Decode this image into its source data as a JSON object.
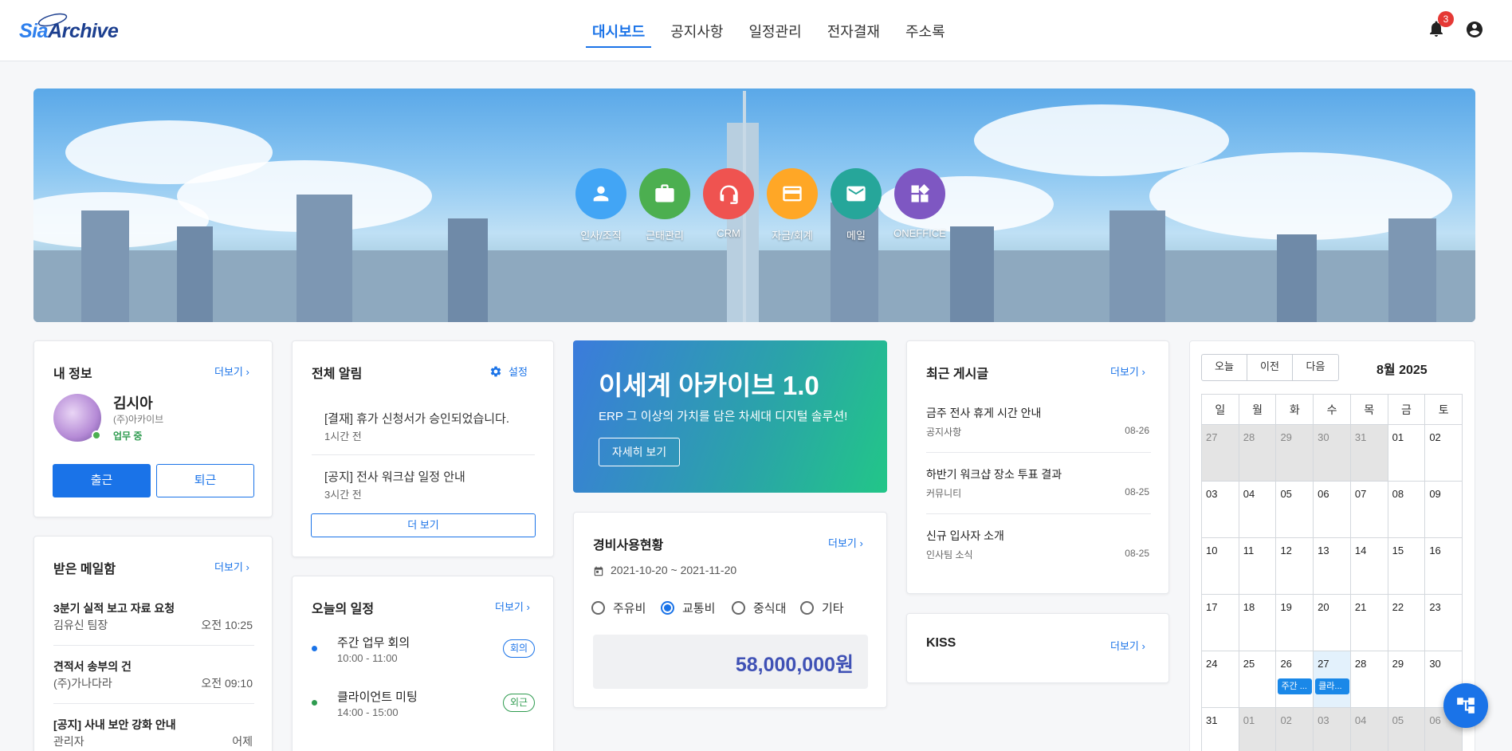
{
  "brand": {
    "logo_text_a": "Sia",
    "logo_text_b": "Archive"
  },
  "nav": [
    {
      "label": "대시보드",
      "active": true
    },
    {
      "label": "공지사항"
    },
    {
      "label": "일정관리"
    },
    {
      "label": "전자결재"
    },
    {
      "label": "주소록"
    }
  ],
  "notifications": {
    "count": "3"
  },
  "apps": [
    {
      "label": "인사/조직",
      "icon": "person-icon",
      "color": "#42a5f5"
    },
    {
      "label": "근태관리",
      "icon": "briefcase-icon",
      "color": "#4caf50"
    },
    {
      "label": "CRM",
      "icon": "headset-icon",
      "color": "#ef5350"
    },
    {
      "label": "자금/회계",
      "icon": "credit-card-icon",
      "color": "#ffa726"
    },
    {
      "label": "메일",
      "icon": "mail-icon",
      "color": "#26a69a"
    },
    {
      "label": "ONEFFICE",
      "icon": "widgets-icon",
      "color": "#7e57c2"
    }
  ],
  "my_info": {
    "title": "내 정보",
    "more": "더보기",
    "name": "김시아",
    "company": "(주)아카이브",
    "status": "업무 중",
    "checkin": "출근",
    "checkout": "퇴근"
  },
  "mail": {
    "title": "받은 메일함",
    "more": "더보기",
    "items": [
      {
        "subject": "3분기 실적 보고 자료 요청",
        "from": "김유신 팀장",
        "time": "오전 10:25"
      },
      {
        "subject": "견적서 송부의 건",
        "from": "(주)가나다라",
        "time": "오전 09:10"
      },
      {
        "subject": "[공지] 사내 보안 강화 안내",
        "from": "관리자",
        "time": "어제"
      }
    ]
  },
  "alerts": {
    "title": "전체 알림",
    "settings": "설정",
    "items": [
      {
        "text": "[결재] 휴가 신청서가 승인되었습니다.",
        "time": "1시간 전"
      },
      {
        "text": "[공지] 전사 워크샵 일정 안내",
        "time": "3시간 전"
      }
    ],
    "more_button": "더 보기"
  },
  "today": {
    "title": "오늘의 일정",
    "more": "더보기",
    "items": [
      {
        "title": "주간 업무 회의",
        "time": "10:00 - 11:00",
        "tag": "회의",
        "color": "#1a73e8"
      },
      {
        "title": "클라이언트 미팅",
        "time": "14:00 - 15:00",
        "tag": "외근",
        "color": "#2e9b4f"
      }
    ]
  },
  "hero": {
    "title": "이세계 아카이브 1.0",
    "subtitle": "ERP 그 이상의 가치를 담은 차세대 디지털 솔루션!",
    "button": "자세히 보기"
  },
  "expense": {
    "title": "경비사용현황",
    "more": "더보기",
    "period": "2021-10-20 ~ 2021-11-20",
    "options": [
      {
        "label": "주유비",
        "checked": false
      },
      {
        "label": "교통비",
        "checked": true
      },
      {
        "label": "중식대",
        "checked": false
      },
      {
        "label": "기타",
        "checked": false
      }
    ],
    "amount": "58,000,000원"
  },
  "posts": {
    "title": "최근 게시글",
    "more": "더보기",
    "items": [
      {
        "title": "금주 전사 휴게 시간 안내",
        "board": "공지사항",
        "date": "08-26"
      },
      {
        "title": "하반기 워크샵 장소 투표 결과",
        "board": "커뮤니티",
        "date": "08-25"
      },
      {
        "title": "신규 입사자 소개",
        "board": "인사팀 소식",
        "date": "08-25"
      }
    ]
  },
  "kiss": {
    "title": "KISS",
    "more": "더보기"
  },
  "calendar": {
    "today": "오늘",
    "prev": "이전",
    "next": "다음",
    "month": "8월 2025",
    "weekdays": [
      "일",
      "월",
      "화",
      "수",
      "목",
      "금",
      "토"
    ],
    "weeks": [
      [
        {
          "d": "27",
          "o": true
        },
        {
          "d": "28",
          "o": true
        },
        {
          "d": "29",
          "o": true
        },
        {
          "d": "30",
          "o": true
        },
        {
          "d": "31",
          "o": true
        },
        {
          "d": "01"
        },
        {
          "d": "02"
        }
      ],
      [
        {
          "d": "03"
        },
        {
          "d": "04"
        },
        {
          "d": "05"
        },
        {
          "d": "06"
        },
        {
          "d": "07"
        },
        {
          "d": "08"
        },
        {
          "d": "09"
        }
      ],
      [
        {
          "d": "10"
        },
        {
          "d": "11"
        },
        {
          "d": "12"
        },
        {
          "d": "13"
        },
        {
          "d": "14"
        },
        {
          "d": "15"
        },
        {
          "d": "16"
        }
      ],
      [
        {
          "d": "17"
        },
        {
          "d": "18"
        },
        {
          "d": "19"
        },
        {
          "d": "20"
        },
        {
          "d": "21"
        },
        {
          "d": "22"
        },
        {
          "d": "23"
        }
      ],
      [
        {
          "d": "24"
        },
        {
          "d": "25"
        },
        {
          "d": "26",
          "ev": "주간 ..."
        },
        {
          "d": "27",
          "today": true,
          "ev": "클라..."
        },
        {
          "d": "28"
        },
        {
          "d": "29"
        },
        {
          "d": "30"
        }
      ],
      [
        {
          "d": "31"
        },
        {
          "d": "01",
          "o": true
        },
        {
          "d": "02",
          "o": true
        },
        {
          "d": "03",
          "o": true
        },
        {
          "d": "04",
          "o": true
        },
        {
          "d": "05",
          "o": true
        },
        {
          "d": "06",
          "o": true
        }
      ]
    ]
  }
}
